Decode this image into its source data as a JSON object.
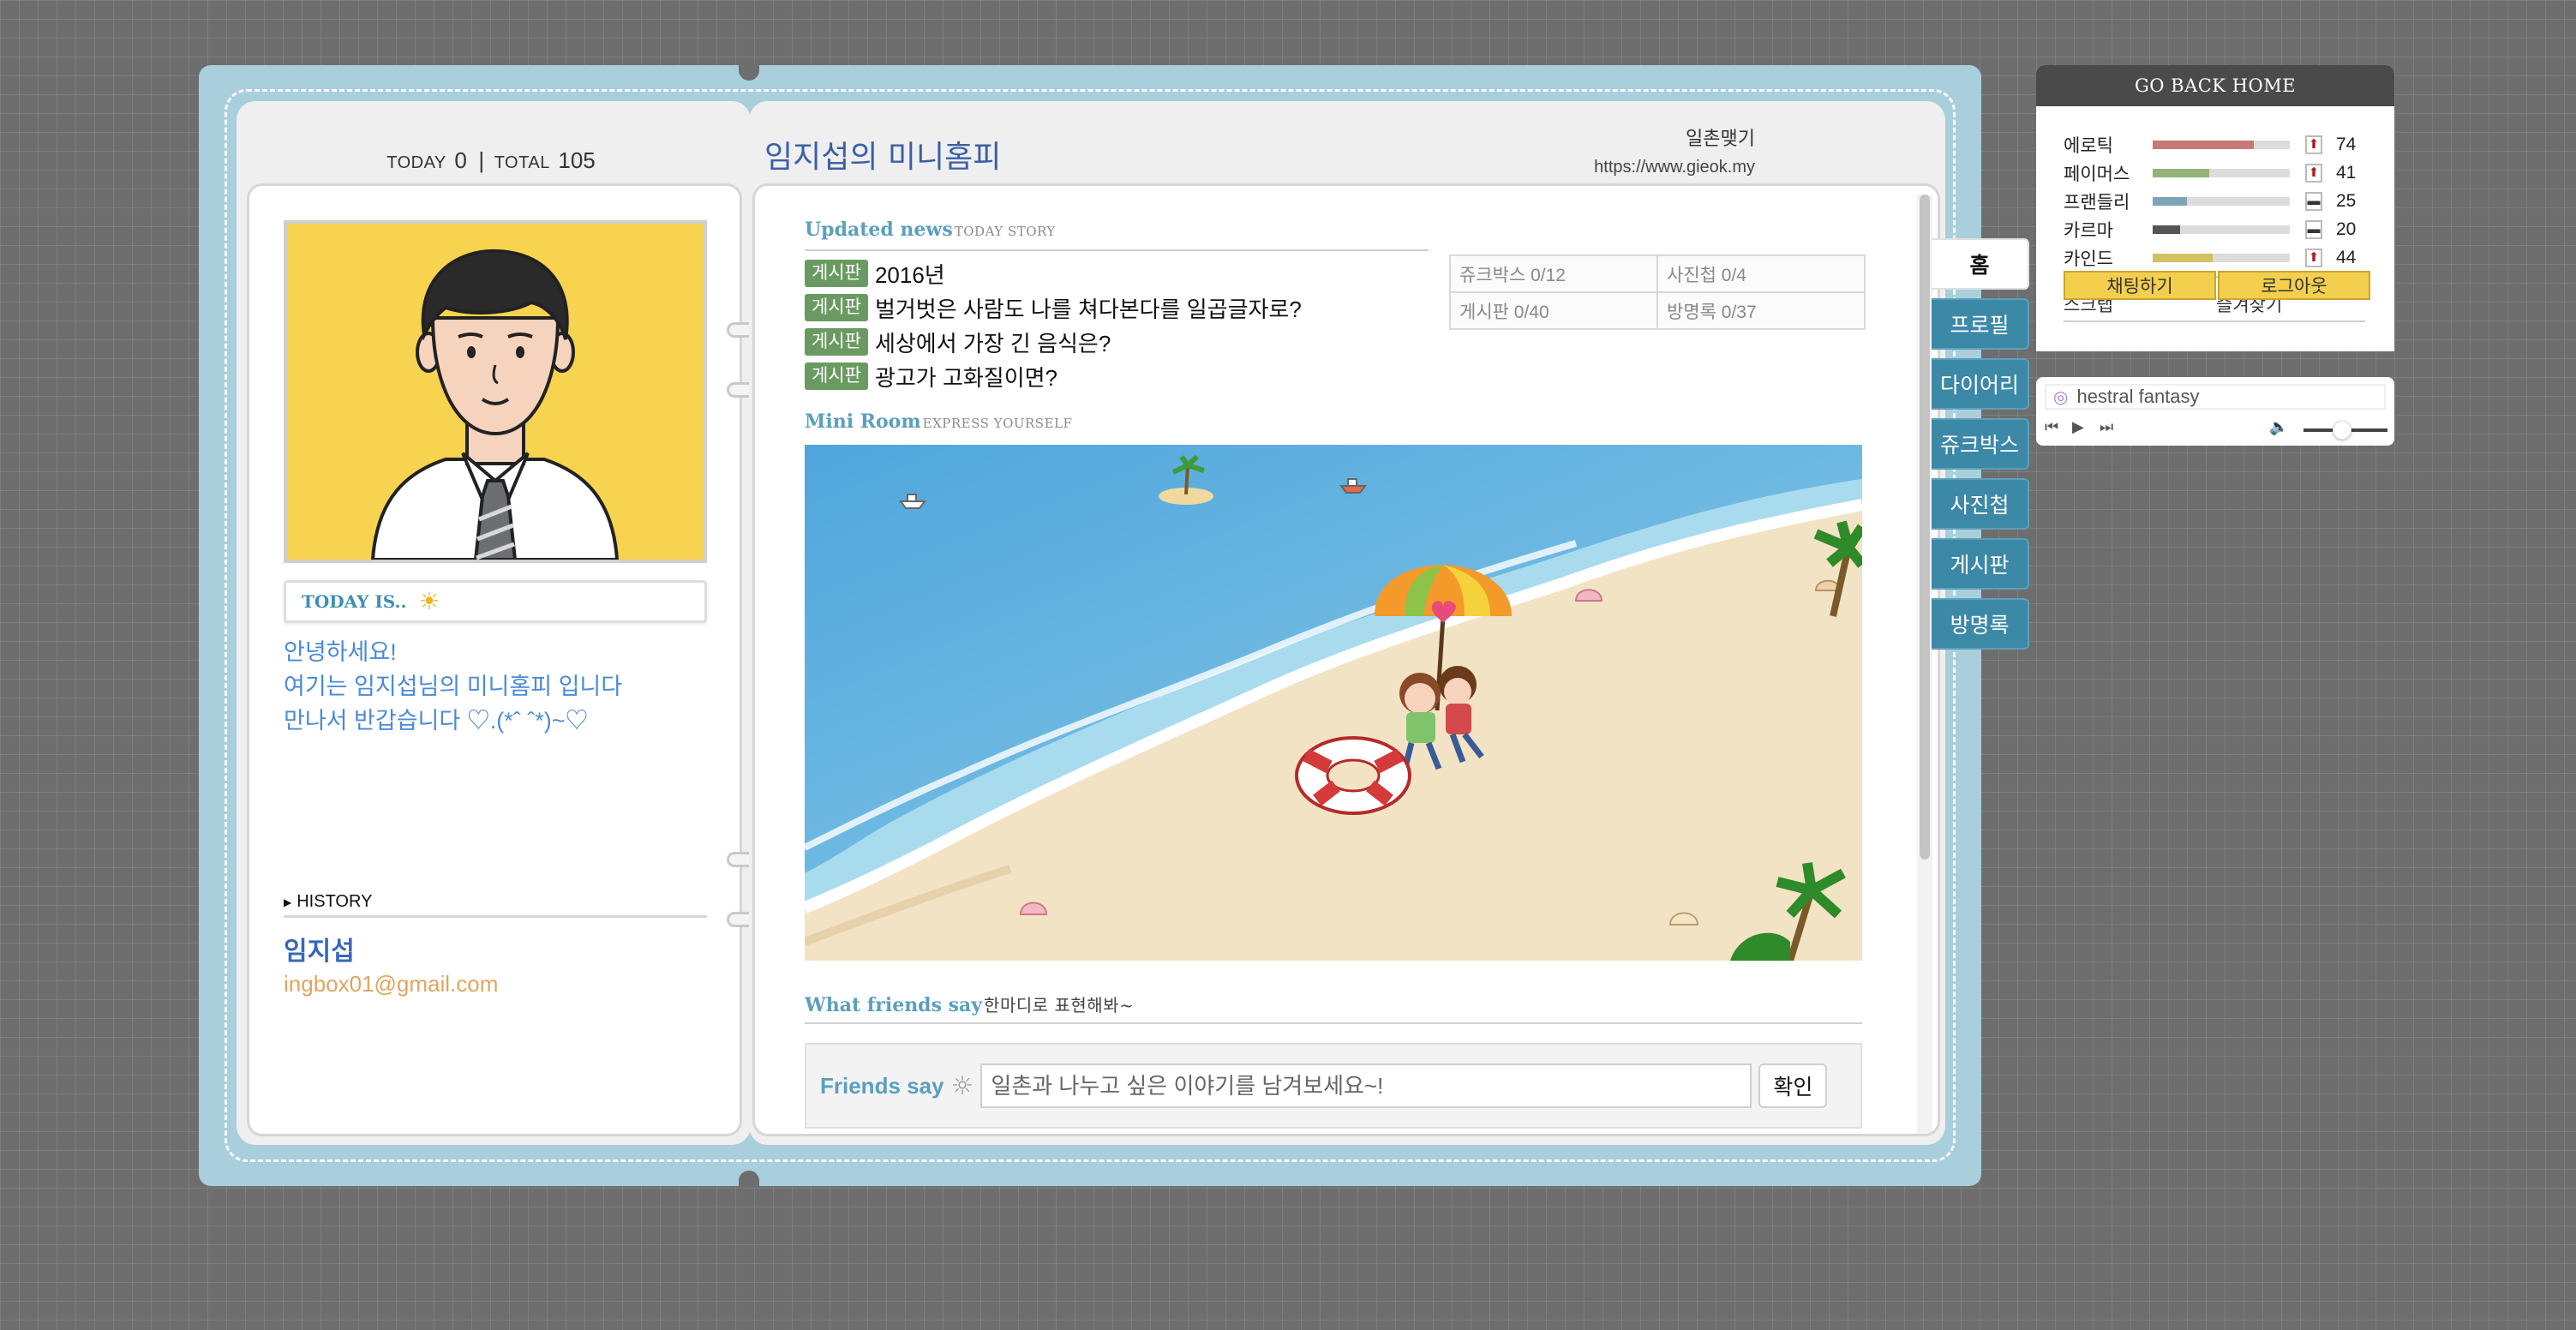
{
  "counter": {
    "today_label": "TODAY",
    "today_value": "0",
    "separator": "|",
    "total_label": "TOTAL",
    "total_value": "105"
  },
  "left": {
    "today_is_label": "TODAY IS..",
    "greeting": [
      "안녕하세요!",
      "여기는 임지섭님의 미니홈피 입니다",
      "만나서 반갑습니다 ♡.(*ˆ ˆ*)~♡"
    ],
    "history_label": "HISTORY",
    "owner_name": "임지섭",
    "owner_email": "ingbox01@gmail.com"
  },
  "header": {
    "title": "임지섭의 미니홈피",
    "ilchon_link": "일촌맺기",
    "url": "https://www.gieok.my"
  },
  "updated_news": {
    "title": "Updated news",
    "subtitle": "TODAY STORY",
    "items": [
      {
        "tag": "게시판",
        "text": "2016년"
      },
      {
        "tag": "게시판",
        "text": "벌거벗은 사람도 나를 쳐다본다를 일곱글자로?"
      },
      {
        "tag": "게시판",
        "text": "세상에서 가장 긴 음식은?"
      },
      {
        "tag": "게시판",
        "text": "광고가 고화질이면?"
      }
    ]
  },
  "stats_table": {
    "rows": [
      [
        "쥬크박스 0/12",
        "사진첩 0/4"
      ],
      [
        "게시판 0/40",
        "방명록 0/37"
      ]
    ]
  },
  "mini_room": {
    "title": "Mini Room",
    "subtitle": "EXPRESS YOURSELF"
  },
  "friends": {
    "title": "What friends say",
    "subtitle": "한마디로 표현해봐~",
    "label": "Friends say",
    "placeholder": "일촌과 나누고 싶은 이야기를 남겨보세요~!",
    "confirm": "확인"
  },
  "tabs": [
    "홈",
    "프로필",
    "다이어리",
    "쥬크박스",
    "사진첩",
    "게시판",
    "방명록"
  ],
  "widget": {
    "title": "GO BACK HOME",
    "stats": [
      {
        "name": "에로틱",
        "value": "74",
        "level": 0.74,
        "color": "#c97878",
        "trend": "up"
      },
      {
        "name": "페이머스",
        "value": "41",
        "level": 0.41,
        "color": "#93b37a",
        "trend": "up"
      },
      {
        "name": "프랜들리",
        "value": "25",
        "level": 0.25,
        "color": "#7fa3b7",
        "trend": "flat"
      },
      {
        "name": "카르마",
        "value": "20",
        "level": 0.2,
        "color": "#555555",
        "trend": "flat"
      },
      {
        "name": "카인드",
        "value": "44",
        "level": 0.44,
        "color": "#d4c060",
        "trend": "up"
      }
    ],
    "link_scrap": "스크랩",
    "link_favorites": "즐겨찾기",
    "btn_chat": "채팅하기",
    "btn_logout": "로그아웃"
  },
  "player": {
    "song": "hestral fantasy"
  },
  "colors": {
    "accent": "#3c88a7",
    "frame": "#a9cfdd",
    "tag": "#6a9a62",
    "button": "#f4cf4e"
  }
}
